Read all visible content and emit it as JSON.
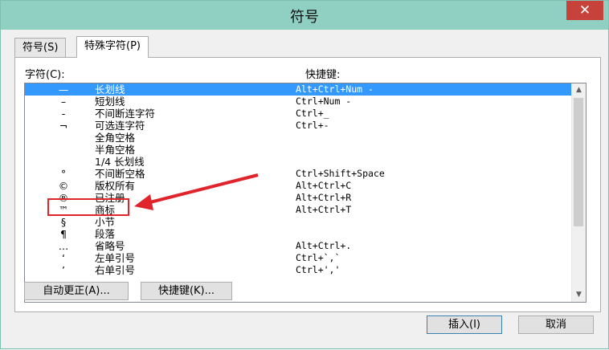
{
  "window": {
    "title": "符号",
    "close_glyph": "✕"
  },
  "tabs": [
    {
      "label": "符号(S)"
    },
    {
      "label": "特殊字符(P)"
    }
  ],
  "list_headers": {
    "char": "字符(C):",
    "shortcut": "快捷键:"
  },
  "rows": [
    {
      "symbol": "—",
      "name": "长划线",
      "shortcut": "Alt+Ctrl+Num -",
      "selected": true
    },
    {
      "symbol": "–",
      "name": "短划线",
      "shortcut": "Ctrl+Num -"
    },
    {
      "symbol": "‑",
      "name": "不间断连字符",
      "shortcut": "Ctrl+_"
    },
    {
      "symbol": "¬",
      "name": "可选连字符",
      "shortcut": "Ctrl+-"
    },
    {
      "symbol": "",
      "name": "全角空格",
      "shortcut": ""
    },
    {
      "symbol": "",
      "name": "半角空格",
      "shortcut": ""
    },
    {
      "symbol": "",
      "name": "1/4 长划线",
      "shortcut": ""
    },
    {
      "symbol": "°",
      "name": "不间断空格",
      "shortcut": "Ctrl+Shift+Space"
    },
    {
      "symbol": "©",
      "name": "版权所有",
      "shortcut": "Alt+Ctrl+C"
    },
    {
      "symbol": "®",
      "name": "已注册",
      "shortcut": "Alt+Ctrl+R"
    },
    {
      "symbol": "™",
      "name": "商标",
      "shortcut": "Alt+Ctrl+T"
    },
    {
      "symbol": "§",
      "name": "小节",
      "shortcut": ""
    },
    {
      "symbol": "¶",
      "name": "段落",
      "shortcut": ""
    },
    {
      "symbol": "…",
      "name": "省略号",
      "shortcut": "Alt+Ctrl+."
    },
    {
      "symbol": "‘",
      "name": "左单引号",
      "shortcut": "Ctrl+`,`"
    },
    {
      "symbol": "’",
      "name": "右单引号",
      "shortcut": "Ctrl+','"
    }
  ],
  "buttons": {
    "autocorrect": "自动更正(A)...",
    "shortcut": "快捷键(K)...",
    "insert": "插入(I)",
    "cancel": "取消"
  },
  "colors": {
    "title_bar": "#8fd0c3",
    "selection": "#3399ff",
    "annotation": "#e0242c"
  }
}
